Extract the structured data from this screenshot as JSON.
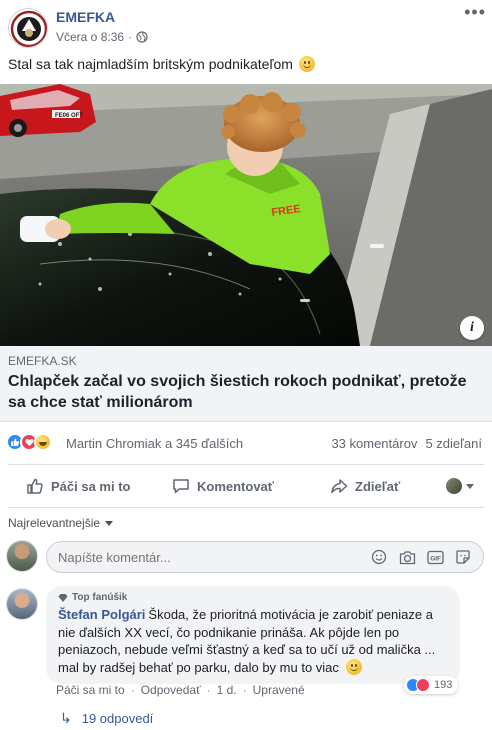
{
  "post": {
    "page_name": "EMEFKA",
    "timestamp": "Včera o 8:36",
    "separator": "·",
    "text": "Stal sa tak najmladším britským podnikateľom",
    "text_emoji": "slightly-smiling-face-icon"
  },
  "link": {
    "domain": "EMEFKA.SK",
    "title": "Chlapček začal vo svojich šiestich rokoch podnikať, pretože sa chce stať milionárom",
    "image_plate": "FE06 OFT",
    "info_label": "i"
  },
  "reactions": {
    "icons": [
      "like-icon",
      "love-icon",
      "haha-icon"
    ],
    "reactors": "Martin Chromiak a 345 ďalších",
    "comments": "33 komentárov",
    "shares": "5 zdieľaní"
  },
  "actions": {
    "like": "Páči sa mi to",
    "comment": "Komentovať",
    "share": "Zdieľať"
  },
  "sort": {
    "label": "Najrelevantnejšie"
  },
  "composer": {
    "placeholder": "Napíšte komentár...",
    "icons": [
      "emoji-icon",
      "camera-icon",
      "gif-icon",
      "sticker-icon"
    ]
  },
  "comment": {
    "badge": "Top fanúšik",
    "author": "Štefan Polgári",
    "text": "Škoda, že prioritná motivácia je zarobiť peniaze a nie ďalších XX vecí, čo podnikanie prináša. Ak pôjde len po peniazoch, nebude veľmi šťastný a keď sa to učí už od malička ... mal by radšej behať po parku, dalo by mu to viac",
    "like": "Páči sa mi to",
    "reply": "Odpovedať",
    "age": "1 d.",
    "edited": "Upravené",
    "dot": "·",
    "reaction_count": "193"
  },
  "replies": {
    "label": "19 odpovedí"
  },
  "colors": {
    "link_blue": "#385898",
    "like_blue": "#2d88ff",
    "love_red": "#f33e58",
    "shirt_green": "#7ed321"
  }
}
